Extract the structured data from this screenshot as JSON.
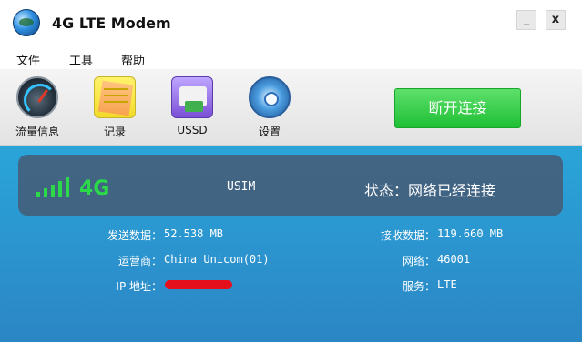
{
  "window": {
    "title": "4G LTE Modem",
    "minimize_label": "_",
    "close_label": "x"
  },
  "menu": [
    "文件",
    "工具",
    "帮助"
  ],
  "toolbar": {
    "items": [
      {
        "label": "流量信息",
        "icon": "speedometer-icon"
      },
      {
        "label": "记录",
        "icon": "sticky-notes-icon"
      },
      {
        "label": "USSD",
        "icon": "ussd-icon"
      },
      {
        "label": "设置",
        "icon": "gear-icon"
      }
    ],
    "connect_button": "断开连接"
  },
  "status": {
    "network_type": "4G",
    "sim_type": "USIM",
    "connection_text": "状态：网络已经连接",
    "signal_bars": 5
  },
  "info": {
    "sent_label": "发送数据：",
    "sent_value": "52.538 MB",
    "received_label": "接收数据：",
    "received_value": "119.660 MB",
    "carrier_label": "运营商：",
    "carrier_value": "China Unicom(01)",
    "network_label": "网络：",
    "network_value": "46001",
    "ip_label": "IP 地址：",
    "service_label": "服务：",
    "service_value": "LTE"
  },
  "colors": {
    "accent_green": "#2bd94a",
    "panel_blue": "#2b92cd",
    "button_green": "#1fbf35"
  }
}
